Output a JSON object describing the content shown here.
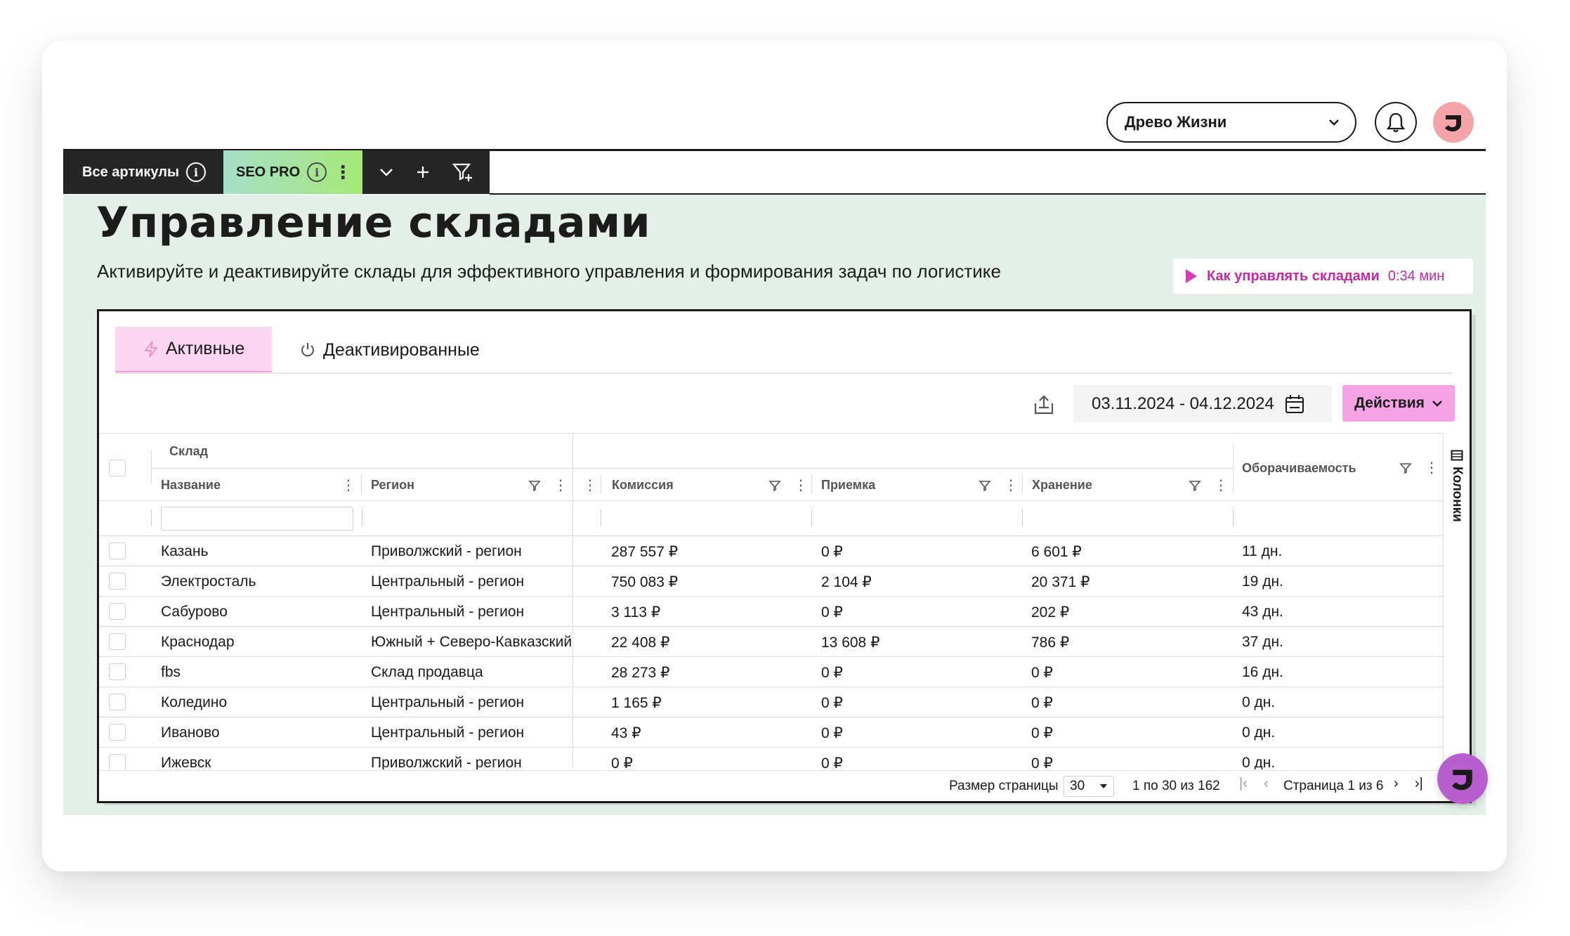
{
  "header": {
    "account": "Древо Жизни",
    "icons": {
      "account_chevron": "chevron-down-icon",
      "notifications": "bell-icon",
      "avatar": "brand-logo"
    }
  },
  "filter_tabs": {
    "all": "Все артикулы",
    "seo": "SEO PRO",
    "tools": [
      "chevron-down-icon",
      "plus-icon",
      "filter-add-icon"
    ]
  },
  "page": {
    "title": "Управление складами",
    "subtitle": "Активируйте и деактивируйте склады для эффективного управления и формирования задач по логистике",
    "howto_title": "Как управлять складами",
    "howto_time": "0:34 мин"
  },
  "tabs": {
    "active": "Активные",
    "inactive": "Деактивированные"
  },
  "toolbar": {
    "date_range": "03.11.2024 - 04.12.2024",
    "actions": "Действия"
  },
  "table": {
    "group_header": "Склад",
    "columns": {
      "name": "Название",
      "region": "Регион",
      "commission": "Комиссия",
      "acceptance": "Приемка",
      "storage": "Хранение",
      "turnover": "Оборачиваемость"
    },
    "rows": [
      {
        "name": "Казань",
        "region": "Приволжский - регион",
        "commission": "287 557 ₽",
        "acceptance": "0 ₽",
        "storage": "6 601 ₽",
        "turnover": "11 дн."
      },
      {
        "name": "Электросталь",
        "region": "Центральный - регион",
        "commission": "750 083 ₽",
        "acceptance": "2 104 ₽",
        "storage": "20 371 ₽",
        "turnover": "19 дн."
      },
      {
        "name": "Сабурово",
        "region": "Центральный - регион",
        "commission": "3 113 ₽",
        "acceptance": "0 ₽",
        "storage": "202 ₽",
        "turnover": "43 дн."
      },
      {
        "name": "Краснодар",
        "region": "Южный + Северо-Кавказский",
        "commission": "22 408 ₽",
        "acceptance": "13 608 ₽",
        "storage": "786 ₽",
        "turnover": "37 дн."
      },
      {
        "name": "fbs",
        "region": "Склад продавца",
        "commission": "28 273 ₽",
        "acceptance": "0 ₽",
        "storage": "0 ₽",
        "turnover": "16 дн."
      },
      {
        "name": "Коледино",
        "region": "Центральный - регион",
        "commission": "1 165 ₽",
        "acceptance": "0 ₽",
        "storage": "0 ₽",
        "turnover": "0 дн."
      },
      {
        "name": "Иваново",
        "region": "Центральный - регион",
        "commission": "43 ₽",
        "acceptance": "0 ₽",
        "storage": "0 ₽",
        "turnover": "0 дн."
      },
      {
        "name": "Ижевск",
        "region": "Приволжский - регион",
        "commission": "0 ₽",
        "acceptance": "0 ₽",
        "storage": "0 ₽",
        "turnover": "0 дн."
      }
    ],
    "side_panel": "Колонки"
  },
  "pagination": {
    "page_size_label": "Размер страницы",
    "page_size": "30",
    "range": "1 по 30 из 162",
    "page_label": "Страница 1 из 6"
  },
  "colors": {
    "accent_pink": "#f5a3e4",
    "tab_pink": "#fad6f0",
    "link_magenta": "#c02aa8",
    "section_bg": "#e4efe8",
    "avatar": "#f4a3a8"
  }
}
